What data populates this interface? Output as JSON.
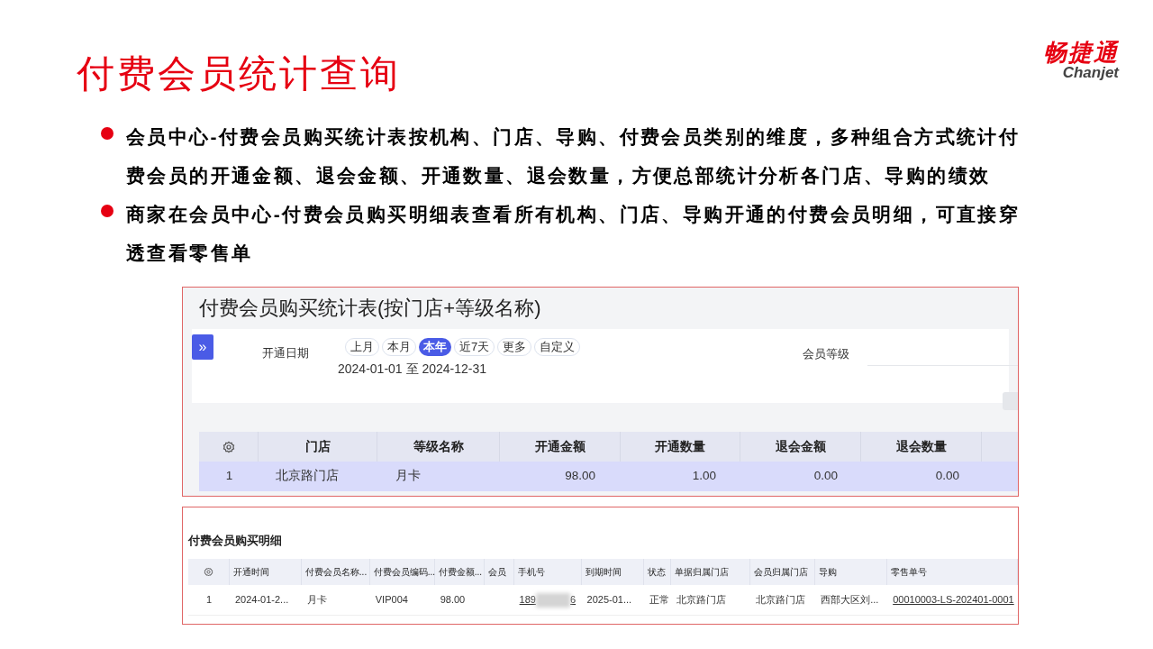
{
  "slide": {
    "title": "付费会员统计查询",
    "logo": {
      "brand": "畅捷通",
      "latin": "Chanjet"
    },
    "bullets": [
      "会员中心-付费会员购买统计表按机构、门店、导购、付费会员类别的维度，多种组合方式统计付费会员的开通金额、退会金额、开通数量、退会数量，方便总部统计分析各门店、导购的绩效",
      "商家在会员中心-付费会员购买明细表查看所有机构、门店、导购开通的付费会员明细，可直接穿透查看零售单"
    ]
  },
  "summary_report": {
    "title": "付费会员购买统计表(按门店+等级名称)",
    "expand_button": "»",
    "filters": {
      "date_label": "开通日期",
      "ranges": [
        {
          "label": "上月",
          "selected": false
        },
        {
          "label": "本月",
          "selected": false
        },
        {
          "label": "本年",
          "selected": true
        },
        {
          "label": "近7天",
          "selected": false
        },
        {
          "label": "更多",
          "selected": false
        },
        {
          "label": "自定义",
          "selected": false
        }
      ],
      "date_range": "2024-01-01 至 2024-12-31",
      "level_label": "会员等级"
    },
    "table": {
      "columns": [
        "",
        "门店",
        "等级名称",
        "开通金额",
        "开通数量",
        "退会金额",
        "退会数量"
      ],
      "rows": [
        {
          "selected": true,
          "cells": [
            "1",
            "北京路门店",
            "月卡",
            "98.00",
            "1.00",
            "0.00",
            "0.00"
          ]
        }
      ]
    }
  },
  "detail_report": {
    "title": "付费会员购买明细",
    "table": {
      "columns": [
        "",
        "开通时间",
        "付费会员名称...",
        "付费会员编码...",
        "付费金额...",
        "会员",
        "手机号",
        "到期时间",
        "状态",
        "单据归属门店",
        "会员归属门店",
        "导购",
        "零售单号"
      ],
      "rows": [
        {
          "cells": [
            "1",
            "2024-01-2...",
            "月卡",
            "VIP004",
            "98.00",
            "",
            "189",
            "2025-01...",
            "正常",
            "北京路门店",
            "北京路门店",
            "西部大区刘...",
            "00010003-LS-202401-0001"
          ],
          "phone_suffix": "6"
        }
      ]
    }
  }
}
